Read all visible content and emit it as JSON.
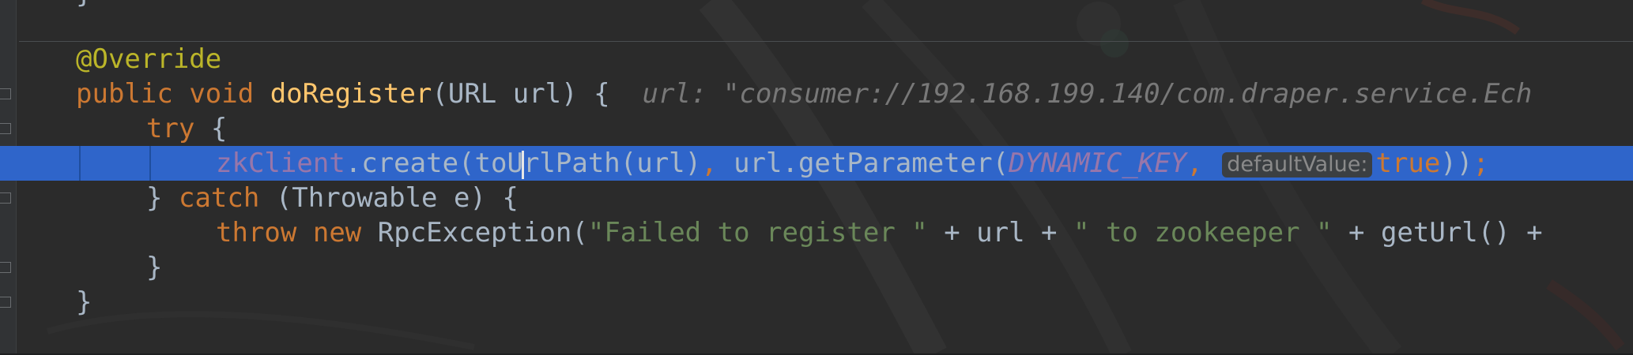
{
  "editor": {
    "top_brace": "}",
    "line1": {
      "annotation": "@Override"
    },
    "line2": {
      "kw1": "public",
      "kw2": "void",
      "method": "doRegister",
      "params": "(URL url) {",
      "hint_label": "url:",
      "hint_value": "\"consumer://192.168.199.140/com.draper.service.Ech"
    },
    "line3": {
      "kw": "try",
      "rest": "{"
    },
    "line4": {
      "field": "zkClient",
      "call1_a": ".create(toU",
      "call1_b": "rlPath(url)",
      "comma1": ",",
      "call2": "url.getParameter(",
      "const": "DYNAMIC_KEY",
      "comma2": ",",
      "param_hint": "defaultValue:",
      "kw_true": "true",
      "close": "))",
      "semicolon": ";"
    },
    "line5": {
      "brace": "}",
      "kw": "catch",
      "rest": "(Throwable e) {"
    },
    "line6": {
      "kw1": "throw",
      "kw2": "new",
      "ctor": "RpcException(",
      "str1": "\"Failed to register \"",
      "op1": "+ url +",
      "str2": "\" to zookeeper \"",
      "op2": "+ getUrl() +"
    },
    "line7": {
      "brace": "}"
    },
    "line8": {
      "brace": "}"
    }
  },
  "colors": {
    "background": "#2b2b2b",
    "selection": "#2f65ca",
    "keyword": "#cc7832",
    "annotation": "#bbb529",
    "method": "#ffc66d",
    "field": "#9876aa",
    "string": "#6a8759",
    "plain": "#a9b7c6"
  }
}
